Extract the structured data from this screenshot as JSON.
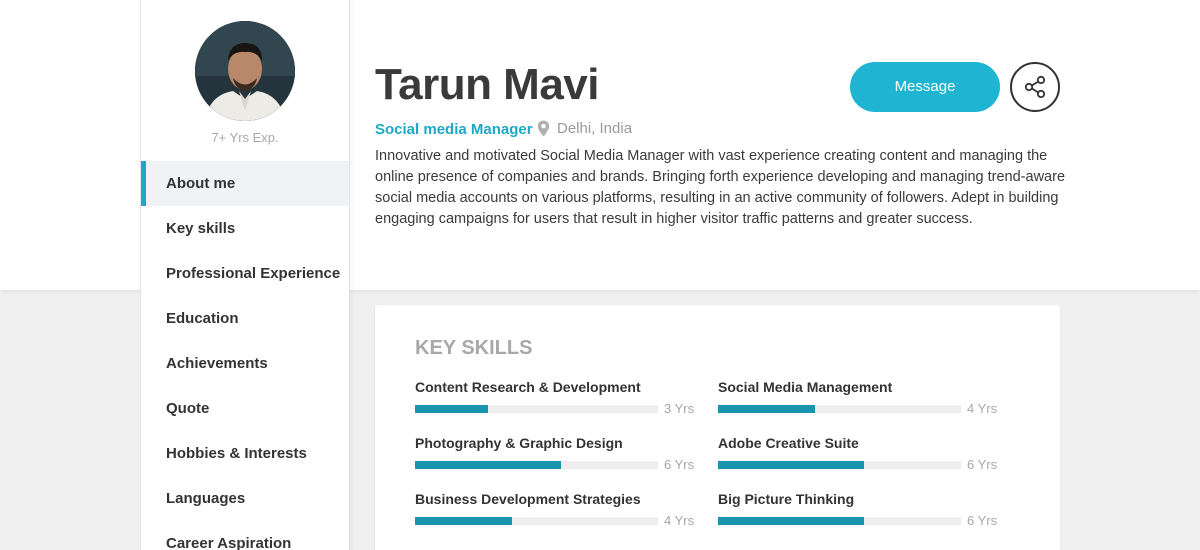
{
  "profile": {
    "name": "Tarun Mavi",
    "role": "Social media Manager",
    "location": "Delhi, India",
    "experience": "7+ Yrs Exp.",
    "bio": "Innovative and motivated Social Media Manager with vast experience creating content and managing the online presence of companies and brands. Bringing forth experience developing and managing trend-aware social media accounts on various platforms, resulting in an active community of followers. Adept in building engaging campaigns for users that result in higher visitor traffic patterns and greater success."
  },
  "actions": {
    "message_label": "Message",
    "share_icon": "share-icon"
  },
  "nav": {
    "items": [
      {
        "label": "About me",
        "active": true
      },
      {
        "label": "Key skills"
      },
      {
        "label": "Professional Experience"
      },
      {
        "label": "Education"
      },
      {
        "label": "Achievements"
      },
      {
        "label": "Quote"
      },
      {
        "label": "Hobbies & Interests"
      },
      {
        "label": "Languages"
      },
      {
        "label": "Career Aspiration"
      }
    ]
  },
  "skills": {
    "title": "KEY SKILLS",
    "items": [
      {
        "name": "Content Research & Development",
        "years_label": "3 Yrs",
        "level": 0.3
      },
      {
        "name": "Social Media Management",
        "years_label": "4 Yrs",
        "level": 0.4
      },
      {
        "name": "Photography & Graphic Design",
        "years_label": "6 Yrs",
        "level": 0.6
      },
      {
        "name": "Adobe Creative Suite",
        "years_label": "6 Yrs",
        "level": 0.6
      },
      {
        "name": "Business Development Strategies",
        "years_label": "4 Yrs",
        "level": 0.4
      },
      {
        "name": "Big Picture Thinking",
        "years_label": "6 Yrs",
        "level": 0.6
      }
    ]
  },
  "colors": {
    "accent": "#1fb4d2",
    "bar": "#1795ac",
    "role_text": "#1fa8c4"
  }
}
